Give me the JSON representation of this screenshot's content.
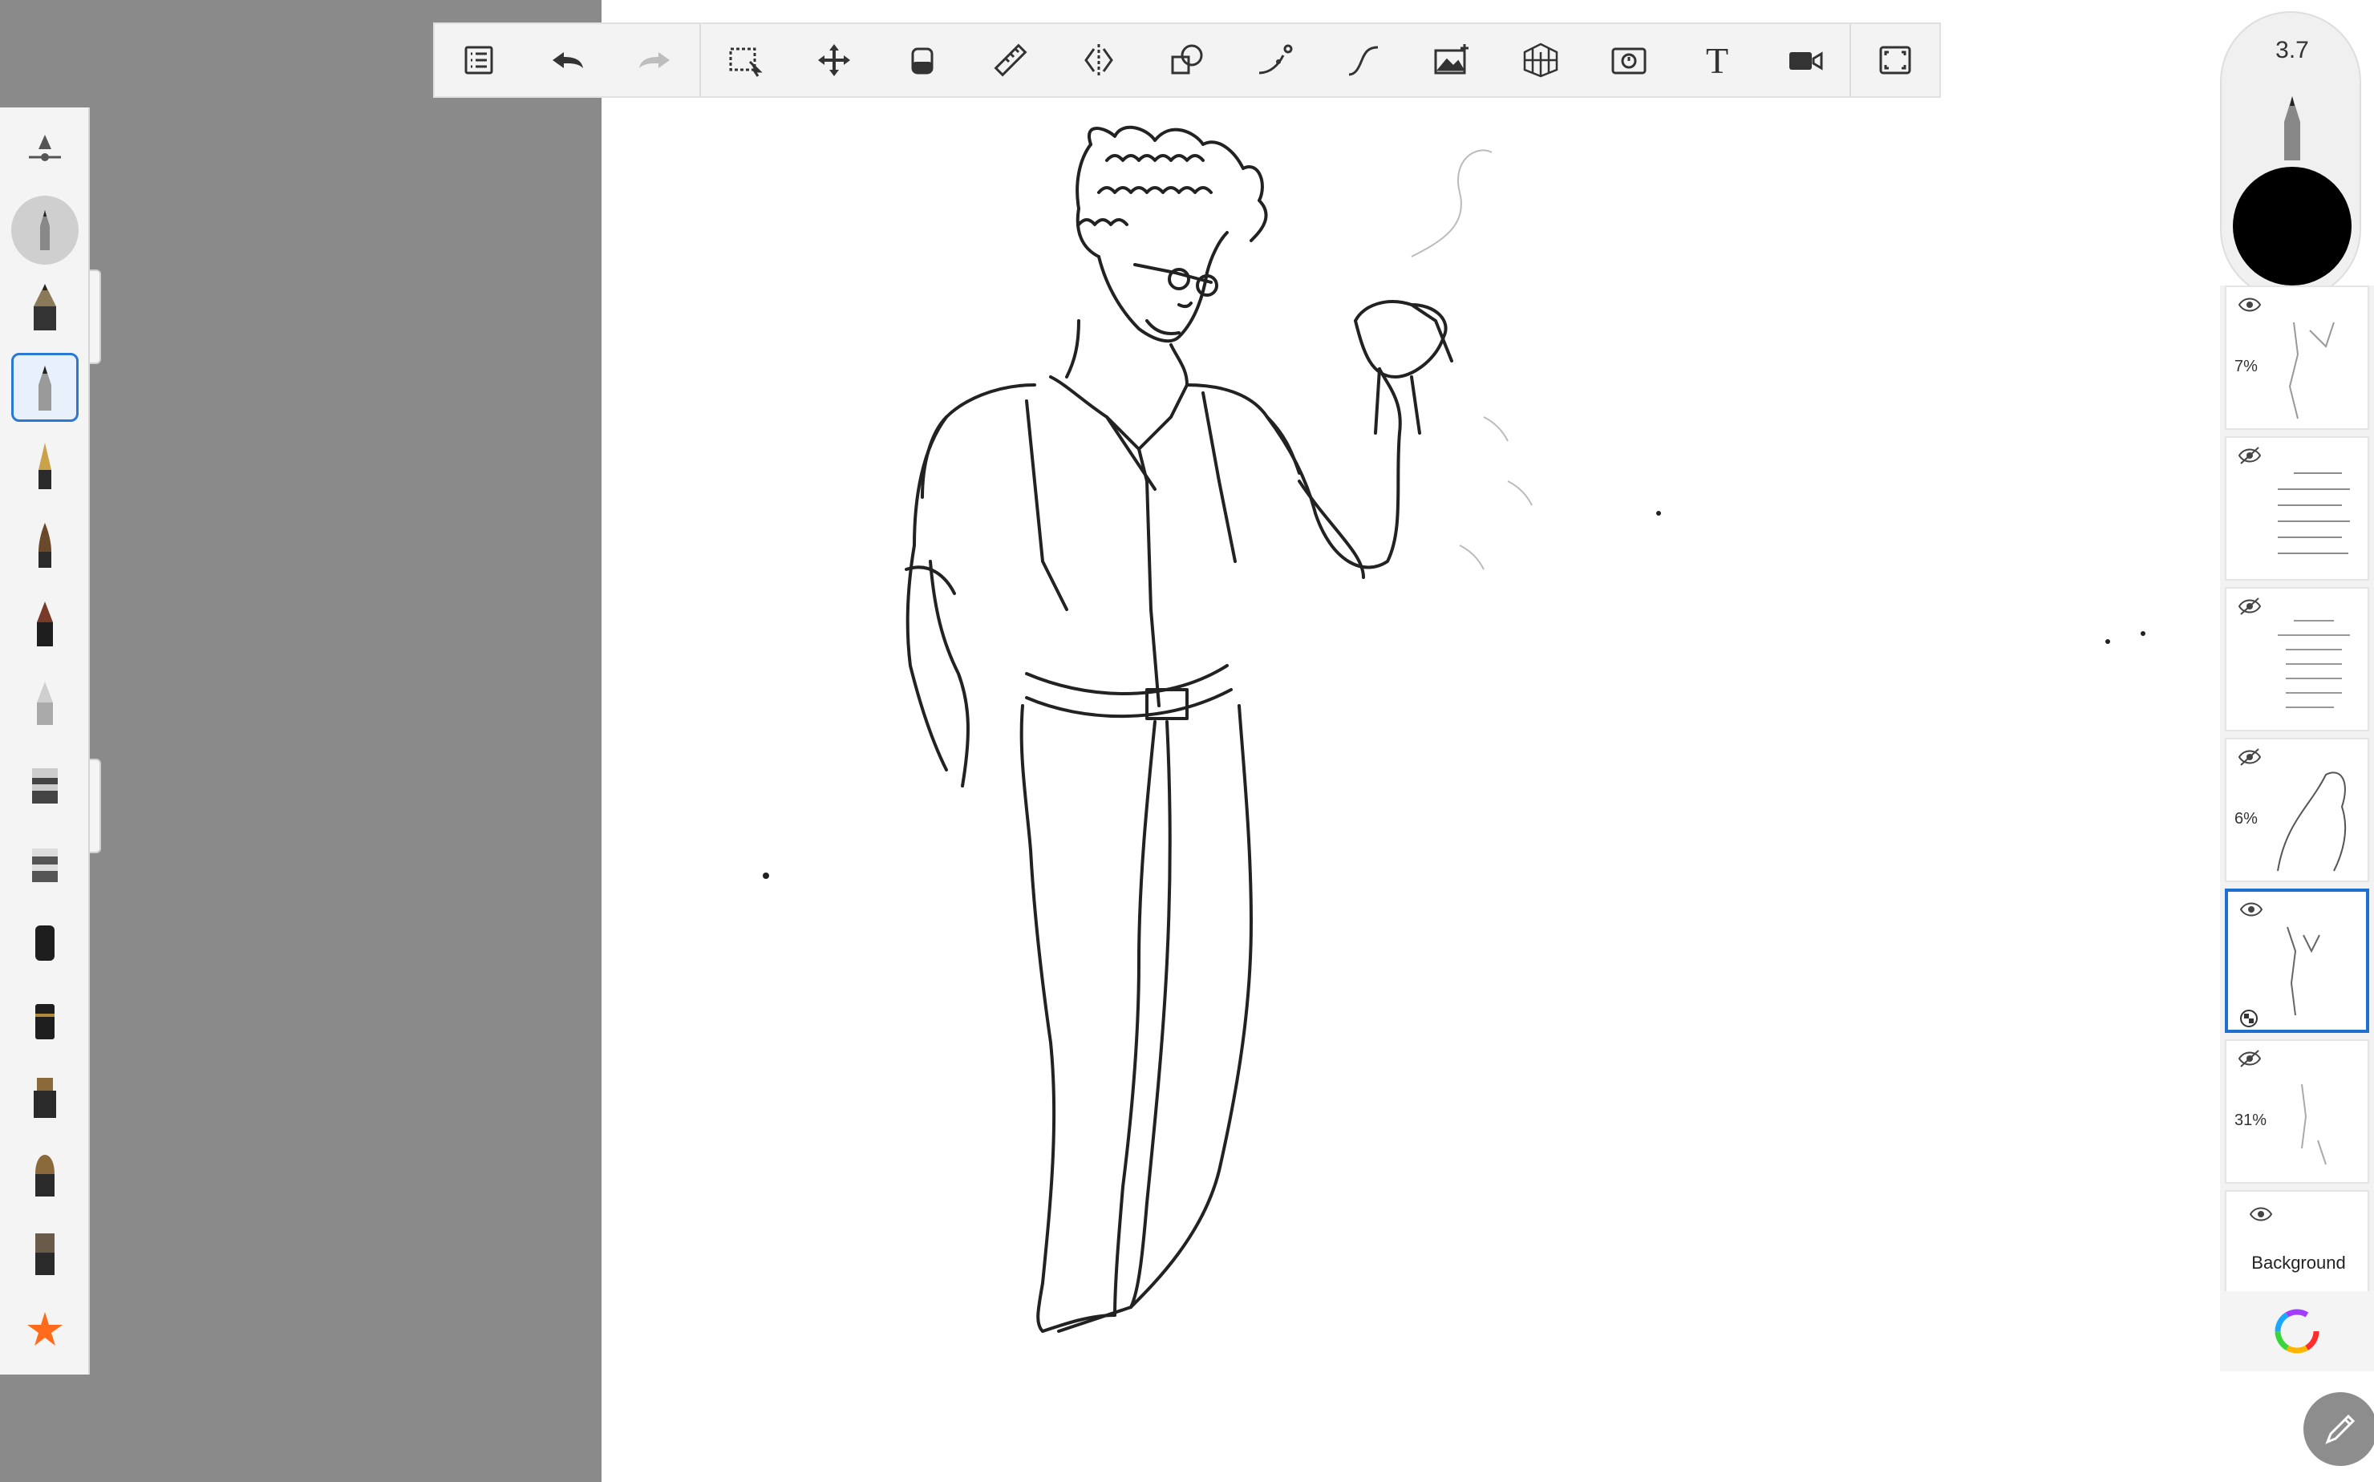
{
  "app": {
    "window_title": ""
  },
  "toolbar": {
    "buttons": [
      {
        "name": "layers-list-icon"
      },
      {
        "name": "undo-icon"
      },
      {
        "name": "redo-icon"
      },
      {
        "name": "selection-icon"
      },
      {
        "name": "transform-move-icon"
      },
      {
        "name": "fill-bucket-icon"
      },
      {
        "name": "ruler-icon"
      },
      {
        "name": "symmetry-icon"
      },
      {
        "name": "shapes-icon"
      },
      {
        "name": "curve-icon"
      },
      {
        "name": "stroke-icon"
      },
      {
        "name": "add-image-icon"
      },
      {
        "name": "perspective-grid-icon"
      },
      {
        "name": "time-lapse-icon"
      },
      {
        "name": "text-icon"
      },
      {
        "name": "video-camera-icon"
      },
      {
        "name": "fullscreen-icon"
      }
    ],
    "text_tool_glyph": "T"
  },
  "brush_palette": {
    "brushes": [
      "brush-settings-slider",
      "pencil-brush-selected-preview",
      "inking-pen",
      "pencil",
      "fountain-pen",
      "paint-brush",
      "marker",
      "airbrush",
      "chisel-marker",
      "wide-marker",
      "felt-tip",
      "bullet-marker",
      "paint-tube",
      "flat-brush",
      "wide-brush",
      "favorites-star"
    ],
    "active_index": 3
  },
  "puck": {
    "brush_size": "3.7",
    "color": "#000000"
  },
  "layers": [
    {
      "visible": true,
      "opacity": "7%",
      "active": false
    },
    {
      "visible": false,
      "opacity": "",
      "active": false
    },
    {
      "visible": false,
      "opacity": "",
      "active": false
    },
    {
      "visible": false,
      "opacity": "6%",
      "active": false
    },
    {
      "visible": true,
      "opacity": "",
      "active": true
    },
    {
      "visible": false,
      "opacity": "31%",
      "active": false
    }
  ],
  "background_layer": {
    "label": "Background",
    "visible": true
  },
  "colors": {
    "accent": "#1f6fd0",
    "active_color": "#000000",
    "favorite_star": "#ff6b1a"
  }
}
